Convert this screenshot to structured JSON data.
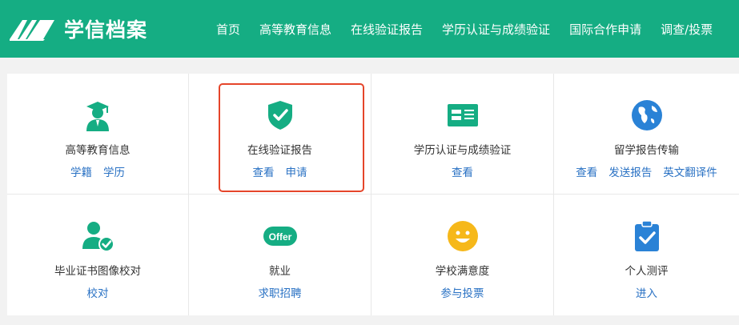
{
  "header": {
    "brand": "学信档案",
    "nav": [
      "首页",
      "高等教育信息",
      "在线验证报告",
      "学历认证与成绩验证",
      "国际合作申请",
      "调查/投票"
    ]
  },
  "services": [
    {
      "title": "高等教育信息",
      "icon": "graduate-icon",
      "links": [
        "学籍",
        "学历"
      ]
    },
    {
      "title": "在线验证报告",
      "icon": "shield-check-icon",
      "links": [
        "查看",
        "申请"
      ]
    },
    {
      "title": "学历认证与成绩验证",
      "icon": "certificate-card-icon",
      "links": [
        "查看"
      ]
    },
    {
      "title": "留学报告传输",
      "icon": "globe-icon",
      "links": [
        "查看",
        "发送报告",
        "英文翻译件"
      ]
    },
    {
      "title": "毕业证书图像校对",
      "icon": "user-check-icon",
      "links": [
        "校对"
      ]
    },
    {
      "title": "就业",
      "icon": "offer-badge-icon",
      "icon_text": "Offer",
      "links": [
        "求职招聘"
      ]
    },
    {
      "title": "学校满意度",
      "icon": "smiley-icon",
      "links": [
        "参与投票"
      ]
    },
    {
      "title": "个人测评",
      "icon": "clipboard-check-icon",
      "links": [
        "进入"
      ]
    }
  ],
  "colors": {
    "brand_green": "#15ad83",
    "link_blue": "#2a72c4",
    "highlight_red": "#e5452a",
    "smiley_yellow": "#f6b81a"
  }
}
